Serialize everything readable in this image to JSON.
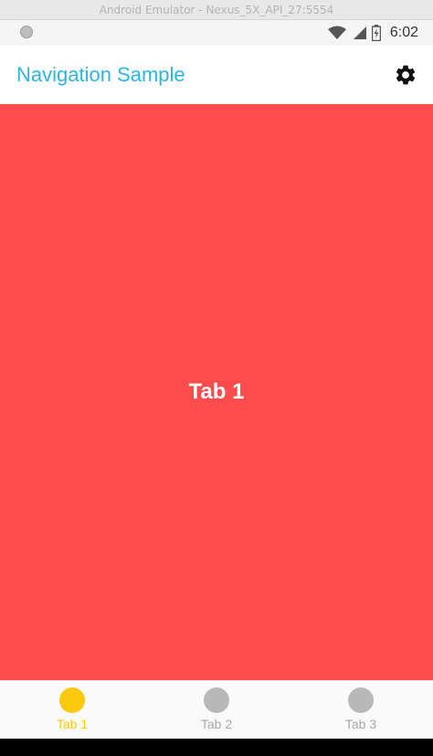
{
  "window": {
    "title": "Android Emulator - Nexus_5X_API_27:5554"
  },
  "status_bar": {
    "time": "6:02"
  },
  "app_bar": {
    "title": "Navigation Sample",
    "title_color": "#2bb5e3",
    "settings_icon": "gear-icon"
  },
  "content": {
    "label": "Tab 1",
    "background": "#fe4b4b"
  },
  "tabs": [
    {
      "label": "Tab 1",
      "active": true
    },
    {
      "label": "Tab 2",
      "active": false
    },
    {
      "label": "Tab 3",
      "active": false
    }
  ],
  "colors": {
    "active_tab": "#fdc90c",
    "inactive_tab": "#b8b8b8"
  }
}
